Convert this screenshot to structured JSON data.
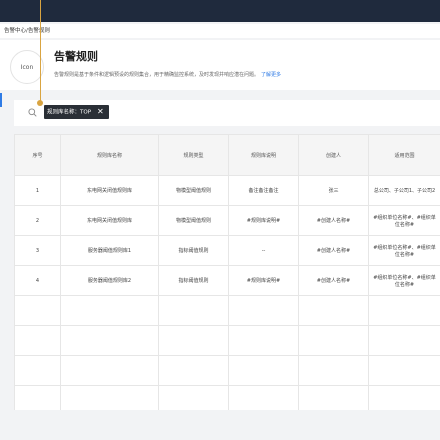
{
  "breadcrumb": "告警中心/告警规则",
  "header": {
    "logo_text": "Icon",
    "title": "告警规则",
    "description": "告警规则是基于条件和逻辑预设的规则集合，用于精确监控系统，及时发现并响应潜在问题。",
    "link": "了解更多"
  },
  "filter": {
    "tag_label": "规则库名称：TOP",
    "close": "✕"
  },
  "table": {
    "columns": [
      "序号",
      "规则库名称",
      "规则类型",
      "规则库说明",
      "创建人",
      "适用范围"
    ],
    "rows": [
      [
        "1",
        "东电网关闭值规则库",
        "物模型阈值规则",
        "备注备注备注",
        "张三",
        "总公司、子公司1、子公司2"
      ],
      [
        "2",
        "东电网关闭值规则库",
        "物模型阈值规则",
        "#规则库说明#",
        "#创建人名称#",
        "#组织单位名称#、#组织单位名称#"
      ],
      [
        "3",
        "服务器阈值规则库1",
        "指标阈值规则",
        "--",
        "#创建人名称#",
        "#组织单位名称#、#组织单位名称#"
      ],
      [
        "4",
        "服务器阈值规则库2",
        "指标阈值规则",
        "#规则库说明#",
        "#创建人名称#",
        "#组织单位名称#、#组织单位名称#"
      ]
    ],
    "empty_rows": 4
  },
  "colors": {
    "topbar": "#1f2a3d",
    "accent": "#2f7be5",
    "annotation": "#d9a441",
    "tag_bg": "#2a2f36"
  }
}
